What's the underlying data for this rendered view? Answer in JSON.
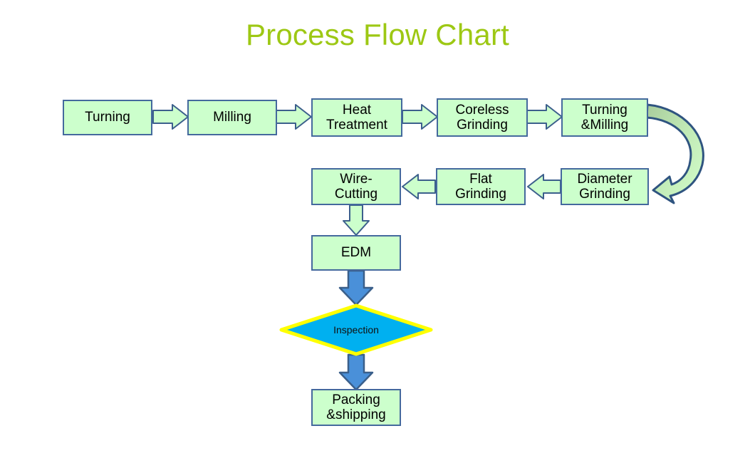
{
  "title": "Process Flow Chart",
  "theme": {
    "title_color": "#9DC814",
    "box_fill": "#CCFFCC",
    "box_border": "#44699D",
    "green_arrow_fill": "#CCFFCC",
    "green_arrow_border": "#3C5F8C",
    "blue_arrow_fill": "#4A90D9",
    "blue_arrow_border": "#3A5F8A",
    "diamond_fill": "#00B0F0",
    "diamond_border": "#FFFF00",
    "background": "#FFFFFF"
  },
  "nodes": [
    {
      "id": "turning",
      "label": "Turning",
      "shape": "process"
    },
    {
      "id": "milling",
      "label": "Milling",
      "shape": "process"
    },
    {
      "id": "heat_treatment",
      "label": "Heat\nTreatment",
      "shape": "process"
    },
    {
      "id": "coreless_grinding",
      "label": "Coreless\nGrinding",
      "shape": "process"
    },
    {
      "id": "turning_milling",
      "label": "Turning\n&Milling",
      "shape": "process"
    },
    {
      "id": "diameter_grinding",
      "label": "Diameter\nGrinding",
      "shape": "process"
    },
    {
      "id": "flat_grinding",
      "label": "Flat\nGrinding",
      "shape": "process"
    },
    {
      "id": "wire_cutting",
      "label": "Wire-\nCutting",
      "shape": "process"
    },
    {
      "id": "edm",
      "label": "EDM",
      "shape": "process"
    },
    {
      "id": "inspection",
      "label": "Inspection",
      "shape": "decision"
    },
    {
      "id": "packing_shipping",
      "label": "Packing\n&shipping",
      "shape": "process"
    }
  ],
  "edges": [
    {
      "from": "turning",
      "to": "milling",
      "style": "green-block",
      "direction": "right"
    },
    {
      "from": "milling",
      "to": "heat_treatment",
      "style": "green-block",
      "direction": "right"
    },
    {
      "from": "heat_treatment",
      "to": "coreless_grinding",
      "style": "green-block",
      "direction": "right"
    },
    {
      "from": "coreless_grinding",
      "to": "turning_milling",
      "style": "green-block",
      "direction": "right"
    },
    {
      "from": "turning_milling",
      "to": "diameter_grinding",
      "style": "green-curved",
      "direction": "down-left"
    },
    {
      "from": "diameter_grinding",
      "to": "flat_grinding",
      "style": "green-block",
      "direction": "left"
    },
    {
      "from": "flat_grinding",
      "to": "wire_cutting",
      "style": "green-block",
      "direction": "left"
    },
    {
      "from": "wire_cutting",
      "to": "edm",
      "style": "green-block",
      "direction": "down"
    },
    {
      "from": "edm",
      "to": "inspection",
      "style": "blue-block",
      "direction": "down"
    },
    {
      "from": "inspection",
      "to": "packing_shipping",
      "style": "blue-block",
      "direction": "down"
    }
  ]
}
